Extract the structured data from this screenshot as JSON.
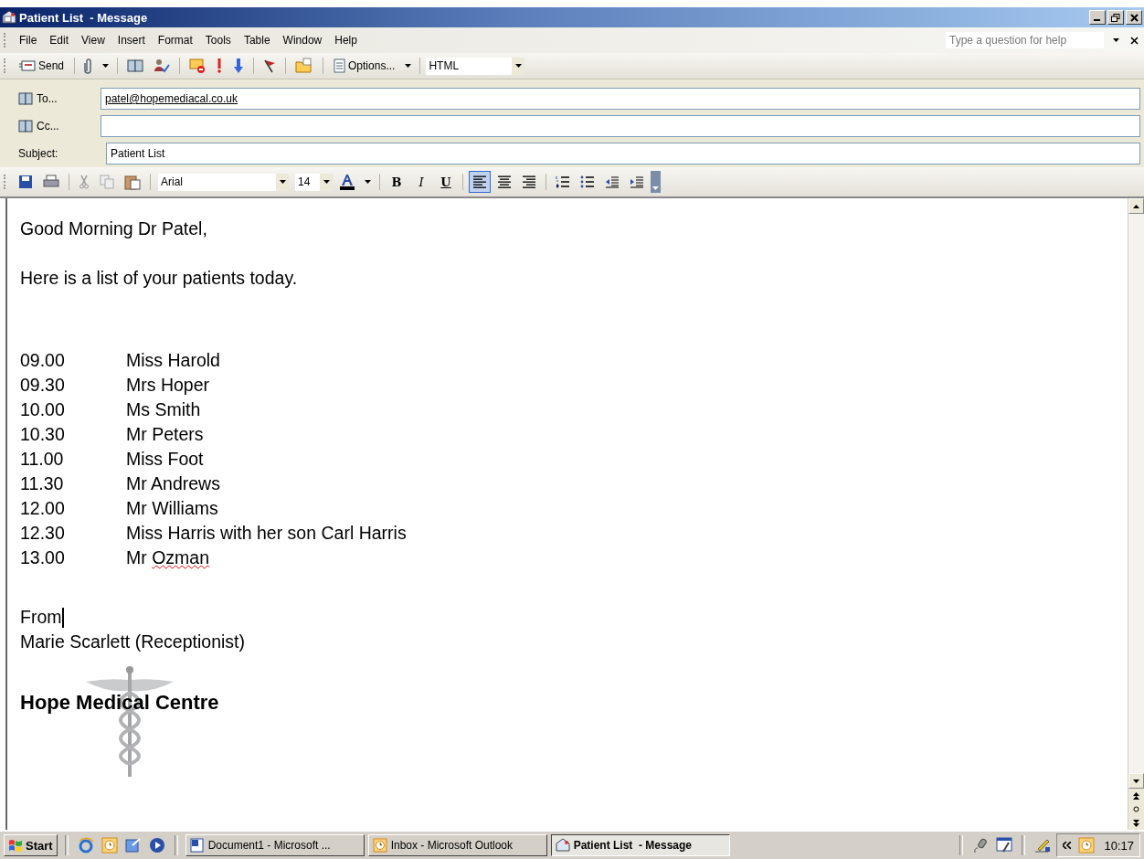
{
  "window": {
    "title": "Patient List  - Message"
  },
  "menu": [
    {
      "label": "File"
    },
    {
      "label": "Edit"
    },
    {
      "label": "View"
    },
    {
      "label": "Insert"
    },
    {
      "label": "Format"
    },
    {
      "label": "Tools"
    },
    {
      "label": "Table"
    },
    {
      "label": "Window"
    },
    {
      "label": "Help"
    }
  ],
  "help_box": {
    "placeholder": "Type a question for help"
  },
  "toolbar": {
    "send": {
      "label": "Send"
    },
    "options": {
      "label": "Options..."
    },
    "format": "HTML"
  },
  "fields": [
    {
      "label": "To...",
      "kind": "address",
      "value": "patel@hopemediacal.co.uk"
    },
    {
      "label": "Cc...",
      "kind": "address"
    },
    {
      "label": "Subject:",
      "kind": "plain",
      "value": "Patient List"
    }
  ],
  "format_bar": {
    "font": "Arial",
    "size": "14",
    "bold": "B",
    "italic": "I",
    "underline": "U",
    "align": [
      {
        "kind": "left",
        "selected": true
      },
      {
        "kind": "center",
        "selected": false
      },
      {
        "kind": "right",
        "selected": false
      }
    ]
  },
  "body": {
    "greeting": "Good Morning Dr Patel,",
    "intro": "Here is a list of your patients today.",
    "appointments": [
      {
        "time": "09.00",
        "name": [
          {
            "text": "Miss Harold",
            "spell_error": false
          }
        ]
      },
      {
        "time": "09.30",
        "name": [
          {
            "text": "Mrs Hoper",
            "spell_error": false
          }
        ]
      },
      {
        "time": "10.00",
        "name": [
          {
            "text": "Ms Smith",
            "spell_error": false
          }
        ]
      },
      {
        "time": "10.30",
        "name": [
          {
            "text": "Mr Peters",
            "spell_error": false
          }
        ]
      },
      {
        "time": "11.00",
        "name": [
          {
            "text": "Miss Foot",
            "spell_error": false
          }
        ]
      },
      {
        "time": "11.30",
        "name": [
          {
            "text": "Mr Andrews",
            "spell_error": false
          }
        ]
      },
      {
        "time": "12.00",
        "name": [
          {
            "text": "Mr Williams",
            "spell_error": false
          }
        ]
      },
      {
        "time": "12.30",
        "name": [
          {
            "text": "Miss Harris with her son Carl Harris",
            "spell_error": false
          }
        ]
      },
      {
        "time": "13.00",
        "name": [
          {
            "text": "Mr ",
            "spell_error": false
          },
          {
            "text": "Ozman",
            "spell_error": true
          }
        ]
      }
    ],
    "from": "From",
    "sender": "Marie Scarlett (Receptionist)",
    "organisation": "Hope Medical Centre"
  },
  "taskbar": {
    "start": "Start",
    "tasks": [
      {
        "label": "Document1 - Microsoft ...",
        "kind": "word",
        "selected": false
      },
      {
        "label": "Inbox - Microsoft Outlook",
        "kind": "outlook",
        "selected": false
      },
      {
        "label": "Patient List  - Message",
        "kind": "message",
        "selected": true
      }
    ],
    "clock": "10:17"
  }
}
